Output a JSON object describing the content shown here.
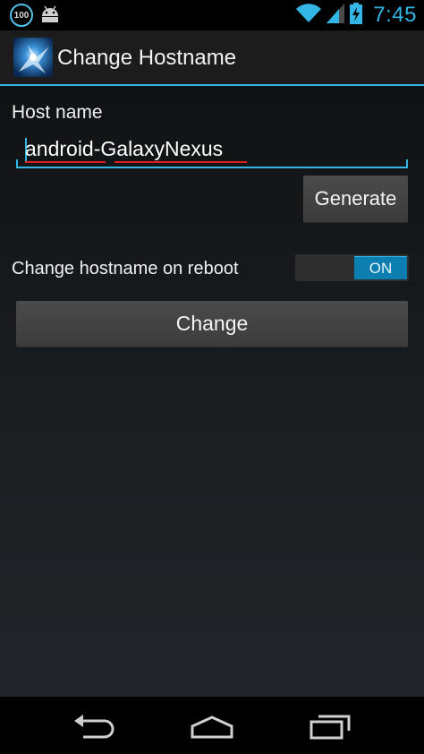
{
  "status_bar": {
    "battery_badge": "100",
    "time": "7:45",
    "icons": [
      "battery-100-badge-icon",
      "android-debug-icon",
      "wifi-icon",
      "signal-icon",
      "battery-charging-icon"
    ]
  },
  "action_bar": {
    "title": "Change Hostname",
    "icon": "app-icon"
  },
  "form": {
    "host_label": "Host name",
    "host_value": "android-GalaxyNexus",
    "generate_label": "Generate",
    "reboot_label": "Change hostname on reboot",
    "toggle_state": "ON",
    "change_label": "Change"
  },
  "nav_bar": {
    "icons": [
      "back-icon",
      "home-icon",
      "recent-apps-icon"
    ]
  },
  "colors": {
    "accent": "#33b5e5",
    "toggle_on": "#0c7fb0",
    "spellcheck": "#e02020"
  }
}
